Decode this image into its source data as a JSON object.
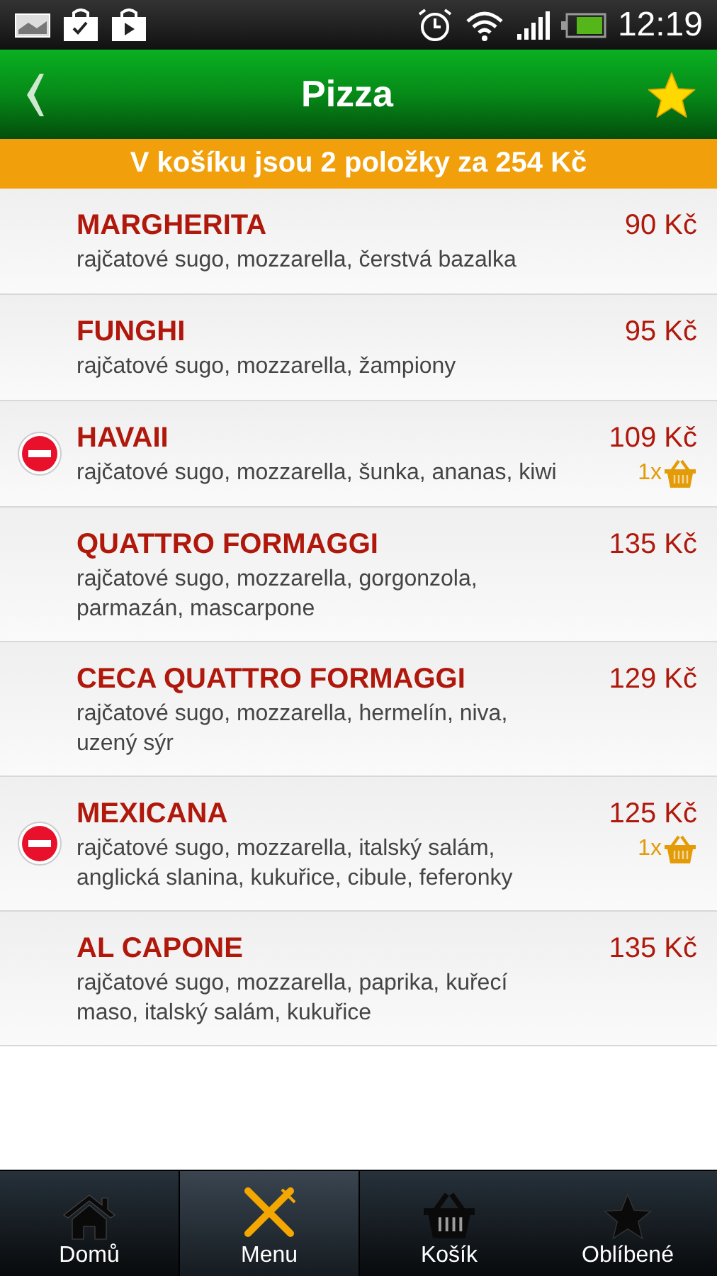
{
  "status_bar": {
    "time": "12:19"
  },
  "header": {
    "title": "Pizza"
  },
  "cart_banner": {
    "text": "V košíku jsou 2 položky za 254 Kč"
  },
  "items": [
    {
      "name": "MARGHERITA",
      "description": "rajčatové sugo, mozzarella, čerstvá bazalka",
      "price": "90 Kč",
      "in_cart": false
    },
    {
      "name": "FUNGHI",
      "description": "rajčatové sugo, mozzarella, žampiony",
      "price": "95 Kč",
      "in_cart": false
    },
    {
      "name": "HAVAII",
      "description": "rajčatové sugo, mozzarella, šunka, ananas, kiwi",
      "price": "109 Kč",
      "in_cart": true,
      "quantity": "1x"
    },
    {
      "name": "QUATTRO FORMAGGI",
      "description": "rajčatové sugo, mozzarella, gorgonzola, parmazán, mascarpone",
      "price": "135 Kč",
      "in_cart": false
    },
    {
      "name": "CECA QUATTRO FORMAGGI",
      "description": "rajčatové sugo, mozzarella, hermelín, niva, uzený sýr",
      "price": "129 Kč",
      "in_cart": false
    },
    {
      "name": "MEXICANA",
      "description": "rajčatové sugo, mozzarella, italský salám, anglická slanina, kukuřice, cibule, feferonky",
      "price": "125 Kč",
      "in_cart": true,
      "quantity": "1x"
    },
    {
      "name": "AL CAPONE",
      "description": "rajčatové sugo, mozzarella, paprika, kuřecí maso, italský salám, kukuřice",
      "price": "135 Kč",
      "in_cart": false
    }
  ],
  "nav": [
    {
      "kind": "home",
      "label": "Domů",
      "selected": false
    },
    {
      "kind": "menu",
      "label": "Menu",
      "selected": true
    },
    {
      "kind": "cart",
      "label": "Košík",
      "selected": false
    },
    {
      "kind": "favorites",
      "label": "Oblíbené",
      "selected": false
    }
  ]
}
